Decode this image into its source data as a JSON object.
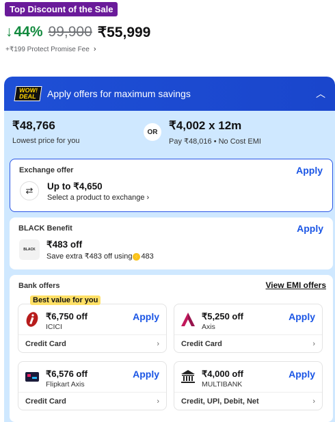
{
  "top_badge": "Top Discount of the Sale",
  "price": {
    "discount": "44%",
    "mrp": "99,900",
    "final": "₹55,999",
    "fee": "+₹199 Protect Promise Fee"
  },
  "offers": {
    "header": {
      "logo_line1": "WOW!",
      "logo_line2": "DEAL",
      "title": "Apply offers for maximum savings"
    },
    "lowest": {
      "price": "₹48,766",
      "price_sub": "Lowest price for you",
      "or": "OR",
      "emi": "₹4,002 x 12m",
      "emi_sub": "Pay ₹48,016 • No Cost EMI"
    },
    "exchange": {
      "label": "Exchange offer",
      "apply": "Apply",
      "title": "Up to ₹4,650",
      "sub": "Select a product to exchange"
    },
    "black": {
      "label": "BLACK Benefit",
      "apply": "Apply",
      "logo": "BLACK",
      "title": "₹483 off",
      "sub_prefix": "Save extra ₹483 off using",
      "coin_value": "483"
    },
    "bank": {
      "label": "Bank offers",
      "view_emi": "View EMI offers",
      "best_tag": "Best value for you",
      "tiles": [
        {
          "amount": "₹6,750 off",
          "bank": "ICICI",
          "apply": "Apply",
          "foot": "Credit Card",
          "icon": "icici-logo-icon"
        },
        {
          "amount": "₹5,250 off",
          "bank": "Axis",
          "apply": "Apply",
          "foot": "Credit Card",
          "icon": "axis-logo-icon"
        },
        {
          "amount": "₹6,576 off",
          "bank": "Flipkart Axis",
          "apply": "Apply",
          "foot": "Credit Card",
          "icon": "flipkart-axis-card-icon"
        },
        {
          "amount": "₹4,000 off",
          "bank": "MULTIBANK",
          "apply": "Apply",
          "foot": "Credit, UPI, Debit, Net",
          "icon": "bank-building-icon"
        }
      ]
    }
  },
  "colors": {
    "badge": "#6a1b9a",
    "discount": "#128a3e",
    "header_blue": "#1e4fd6",
    "panel_bg": "#cfe8ff",
    "apply_blue": "#1a55e5"
  }
}
